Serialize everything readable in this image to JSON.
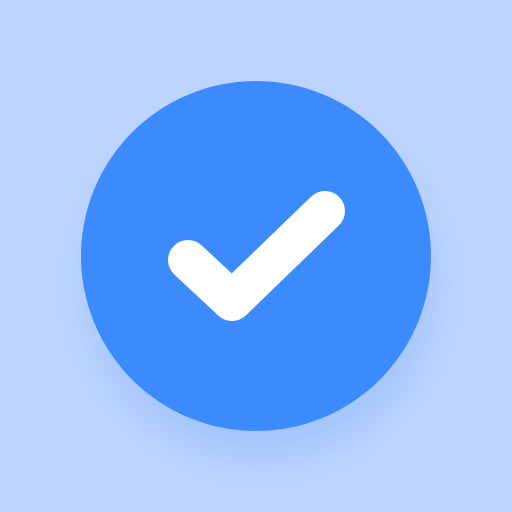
{
  "icon": {
    "name": "checkmark-icon",
    "colors": {
      "background": "#BFD6FE",
      "circle": "#3B8BFC",
      "glow": "#3B82F6",
      "check": "#FFFFFF"
    }
  }
}
